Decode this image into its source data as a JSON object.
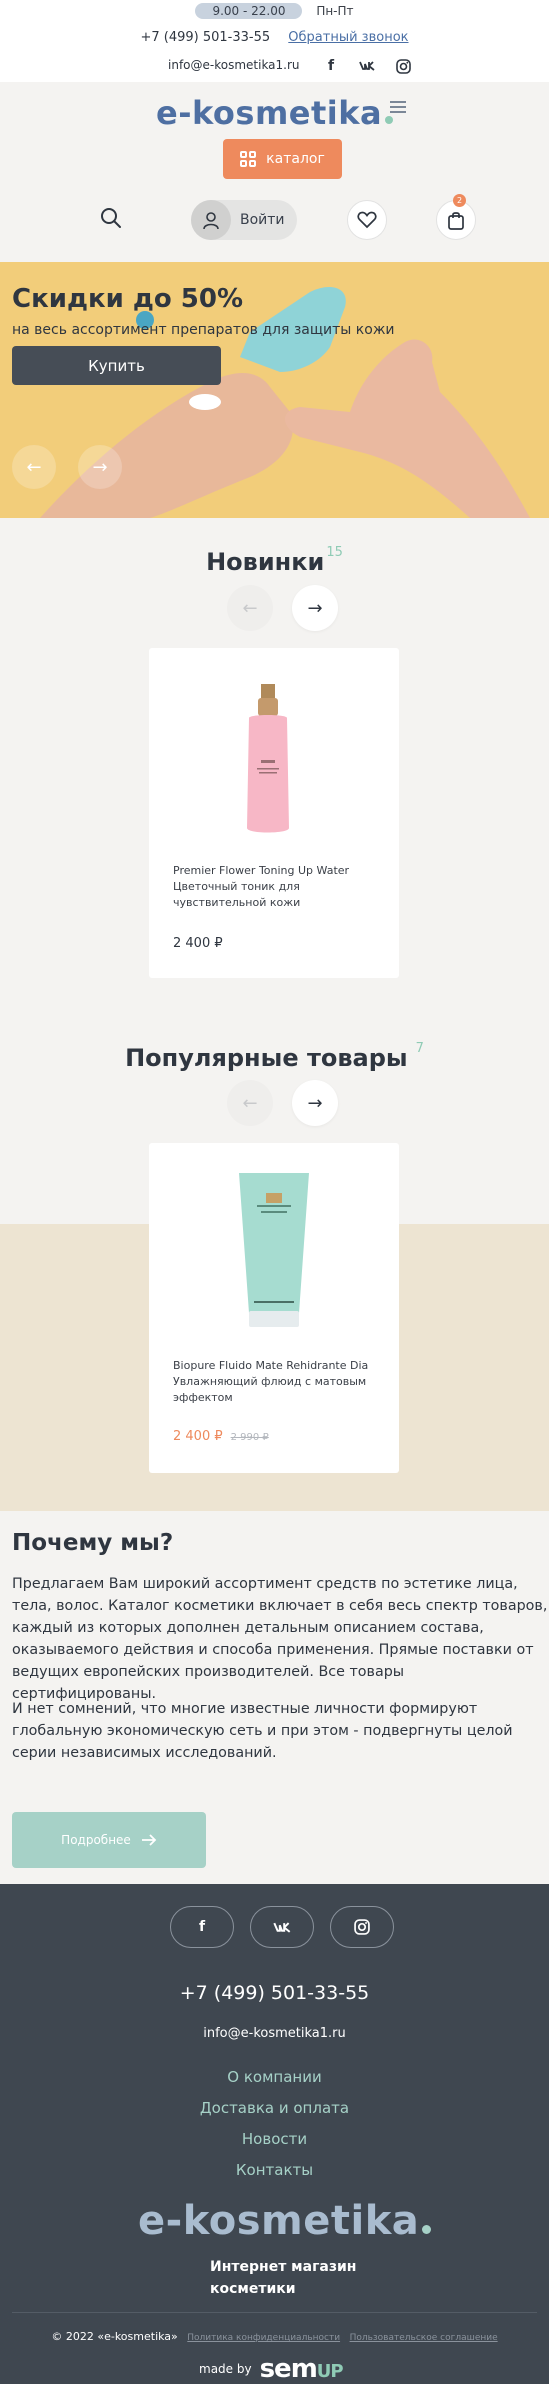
{
  "topbar": {
    "hours": "9.00 - 22.00",
    "days": "Пн-Пт",
    "phone": "+7 (499) 501-33-55",
    "callback": "Обратный звонок",
    "email": "info@e-kosmetika1.ru",
    "social": {
      "facebook": "f",
      "vk": "VK",
      "instagram": "instagram-icon"
    }
  },
  "header": {
    "logo": "e-kosmetika",
    "catalog_label": "каталог",
    "login_label": "Войти",
    "cart_count": "2"
  },
  "hero": {
    "title": "Скидки до 50%",
    "subtitle": "на весь ассортимент препаратов для защиты кожи",
    "button": "Купить",
    "prev": "←",
    "next": "→"
  },
  "new_items": {
    "title": "Новинки",
    "count": "15",
    "product": {
      "name": "Premier Flower Toning Up Water Цветочный тоник для чувствительной кожи",
      "price": "2 400 ₽"
    }
  },
  "popular": {
    "title": "Популярные товары",
    "count": "7",
    "product": {
      "name": "Biopure Fluido Mate Rehidrante Dia Увлажняющий флюид с матовым эффектом",
      "price": "2 400 ₽",
      "old_price": "2 990 ₽"
    }
  },
  "why": {
    "title": "Почему мы?",
    "p1": "Предлагаем Вам широкий ассортимент средств по эстетике лица, тела, волос. Каталог косметики включает в себя весь спектр товаров, каждый из которых дополнен детальным описанием состава, оказываемого действия и способа применения. Прямые поставки от ведущих европейских производителей. Все товары сертифицированы.",
    "p2": "И нет сомнений, что многие известные личности формируют глобальную экономическую сеть и при этом - подвергнуты целой серии независимых исследований.",
    "button": "Подробнее"
  },
  "footer": {
    "phone": "+7 (499) 501-33-55",
    "email": "info@e-kosmetika1.ru",
    "links": [
      "О компании",
      "Доставка и оплата",
      "Новости",
      "Контакты"
    ],
    "logo": "e-kosmetika",
    "tagline_1": "Интернет магазин",
    "tagline_2": "косметики",
    "copyright": "© 2022 «e-kosmetika»",
    "privacy": "Политика конфиденциальности",
    "agreement": "Пользовательское соглашение",
    "made_by": "made by",
    "dev_a": "sem",
    "dev_b": "UP"
  },
  "colors": {
    "accent_orange": "#ee8a5d",
    "brand_blue": "#4e6fa2",
    "mint": "#a6d1c7",
    "dark": "#3f4750"
  }
}
